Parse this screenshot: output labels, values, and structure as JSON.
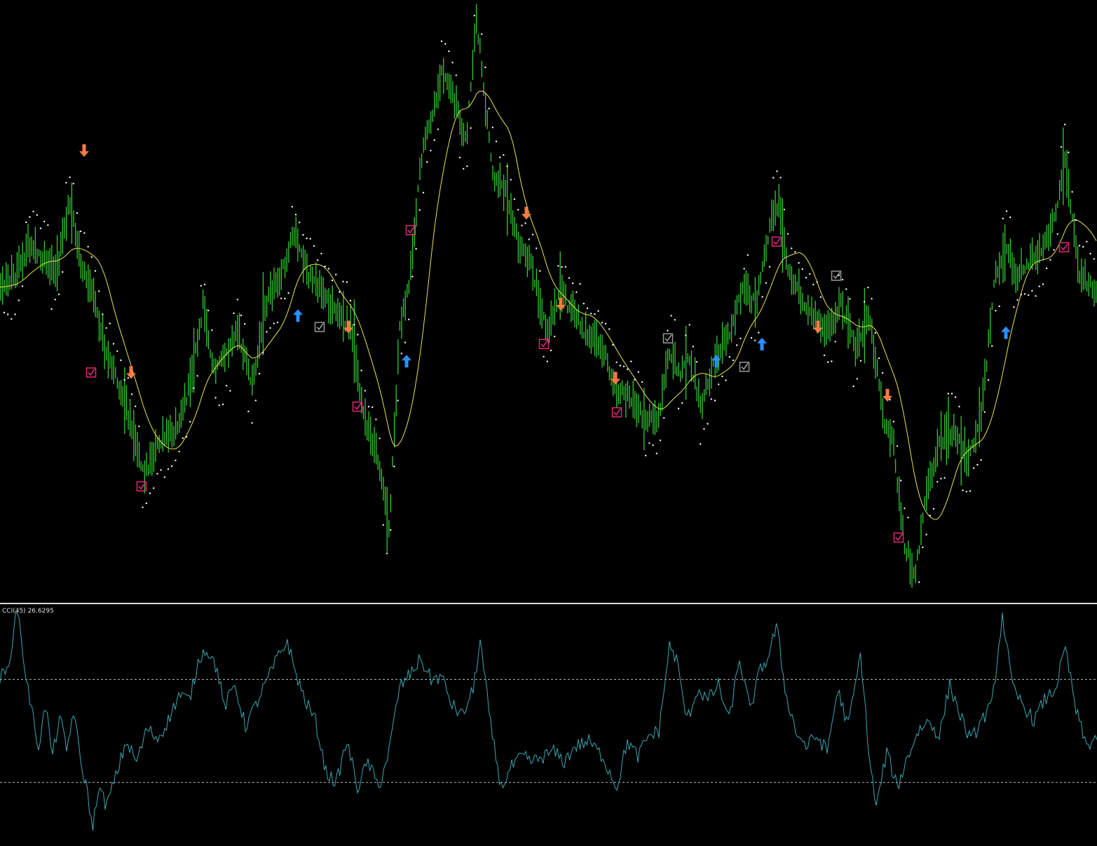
{
  "colors": {
    "background": "#000000",
    "price_bars": "#33cc33",
    "moving_average": "#e6e64d",
    "psar_dots": "#ffffff",
    "cci_line": "#3aa8b4",
    "level_lines": "#bbbbbb",
    "arrow_up": "#2b8fff",
    "arrow_down": "#ff7a45",
    "check_pink": "#e0287a",
    "check_gray": "#9a9a9a",
    "divider": "#d9d9d9"
  },
  "cci_label": {
    "name": "CCI(45)",
    "value": "26.6295"
  },
  "chart_data": [
    {
      "type": "line",
      "panel": "price",
      "x": [
        0,
        22,
        40,
        60,
        80,
        100,
        115,
        130,
        150,
        170,
        190,
        205,
        225,
        250,
        270,
        290,
        305,
        320,
        340,
        360,
        380,
        400,
        420,
        440,
        460,
        480,
        500,
        520,
        540,
        555,
        570,
        585,
        600,
        615,
        630,
        650,
        665,
        680,
        695,
        705,
        720,
        740,
        760,
        780,
        800,
        820,
        840,
        860,
        880,
        900,
        920,
        940,
        955,
        970,
        985,
        1000,
        1020,
        1040,
        1060,
        1080,
        1095,
        1110,
        1125,
        1140,
        1160,
        1180,
        1200,
        1220,
        1240,
        1260,
        1275,
        1290,
        1305,
        1320,
        1340,
        1360,
        1380,
        1400,
        1420,
        1435,
        1450,
        1470,
        1490,
        1505,
        1520,
        1540,
        1565
      ],
      "y": [
        0.53,
        0.55,
        0.6,
        0.58,
        0.55,
        0.68,
        0.57,
        0.52,
        0.42,
        0.35,
        0.28,
        0.2,
        0.25,
        0.28,
        0.35,
        0.5,
        0.38,
        0.4,
        0.45,
        0.36,
        0.5,
        0.55,
        0.62,
        0.55,
        0.52,
        0.48,
        0.46,
        0.3,
        0.22,
        0.1,
        0.45,
        0.55,
        0.75,
        0.82,
        0.9,
        0.85,
        0.78,
        1.0,
        0.82,
        0.72,
        0.7,
        0.6,
        0.56,
        0.45,
        0.52,
        0.48,
        0.44,
        0.42,
        0.35,
        0.33,
        0.3,
        0.3,
        0.42,
        0.38,
        0.4,
        0.32,
        0.4,
        0.45,
        0.52,
        0.5,
        0.62,
        0.68,
        0.55,
        0.52,
        0.48,
        0.45,
        0.5,
        0.42,
        0.48,
        0.3,
        0.25,
        0.08,
        0.02,
        0.15,
        0.25,
        0.28,
        0.22,
        0.3,
        0.55,
        0.6,
        0.55,
        0.58,
        0.6,
        0.65,
        0.75,
        0.55,
        0.52
      ],
      "ylim": [
        0,
        1
      ]
    },
    {
      "type": "line",
      "panel": "cci",
      "x": [
        0,
        10,
        20,
        25,
        35,
        45,
        55,
        65,
        75,
        85,
        95,
        105,
        115,
        125,
        132,
        140,
        152,
        165,
        180,
        195,
        210,
        225,
        240,
        255,
        270,
        285,
        295,
        310,
        320,
        335,
        350,
        365,
        380,
        395,
        410,
        420,
        435,
        450,
        465,
        480,
        495,
        510,
        525,
        540,
        555,
        570,
        585,
        600,
        615,
        630,
        645,
        660,
        675,
        685,
        700,
        715,
        730,
        745,
        760,
        775,
        790,
        805,
        820,
        840,
        860,
        880,
        895,
        910,
        925,
        940,
        955,
        965,
        980,
        995,
        1010,
        1025,
        1040,
        1055,
        1070,
        1085,
        1095,
        1108,
        1120,
        1135,
        1150,
        1165,
        1180,
        1195,
        1210,
        1228,
        1240,
        1250,
        1265,
        1280,
        1295,
        1310,
        1325,
        1340,
        1355,
        1370,
        1385,
        1400,
        1415,
        1430,
        1445,
        1460,
        1475,
        1490,
        1505,
        1520,
        1535,
        1550,
        1565
      ],
      "y": [
        105,
        115,
        195,
        240,
        125,
        40,
        -30,
        50,
        -50,
        30,
        -40,
        40,
        -60,
        -120,
        -195,
        -110,
        -145,
        -90,
        -20,
        -60,
        5,
        -15,
        20,
        70,
        60,
        145,
        160,
        120,
        45,
        90,
        10,
        50,
        95,
        140,
        175,
        120,
        60,
        20,
        -80,
        -100,
        -20,
        -110,
        -60,
        -110,
        -40,
        85,
        110,
        140,
        100,
        105,
        50,
        30,
        80,
        175,
        10,
        -110,
        -70,
        -50,
        -60,
        -50,
        -40,
        -60,
        -30,
        -20,
        -50,
        -110,
        -20,
        -50,
        -10,
        0,
        165,
        140,
        20,
        80,
        60,
        90,
        20,
        140,
        40,
        120,
        140,
        205,
        80,
        0,
        -30,
        -10,
        -40,
        80,
        10,
        150,
        -50,
        -150,
        -40,
        -110,
        -50,
        0,
        20,
        -10,
        90,
        30,
        -20,
        20,
        50,
        225,
        80,
        50,
        20,
        60,
        80,
        160,
        40,
        -30,
        -10,
        -40
      ],
      "ylim": [
        -210,
        230
      ],
      "levels": [
        100,
        -100
      ]
    }
  ],
  "markers": {
    "arrows_up": [
      {
        "x": 425,
        "y": 0.48
      },
      {
        "x": 580,
        "y": 0.4
      },
      {
        "x": 1022,
        "y": 0.4
      },
      {
        "x": 1087,
        "y": 0.43
      },
      {
        "x": 1435,
        "y": 0.45
      }
    ],
    "arrows_down": [
      {
        "x": 120,
        "y": 0.77
      },
      {
        "x": 187,
        "y": 0.38
      },
      {
        "x": 497,
        "y": 0.46
      },
      {
        "x": 751,
        "y": 0.66
      },
      {
        "x": 800,
        "y": 0.5
      },
      {
        "x": 878,
        "y": 0.37
      },
      {
        "x": 1167,
        "y": 0.46
      },
      {
        "x": 1266,
        "y": 0.34
      }
    ],
    "checks_pink": [
      {
        "x": 130,
        "y": 0.38
      },
      {
        "x": 202,
        "y": 0.18
      },
      {
        "x": 510,
        "y": 0.32
      },
      {
        "x": 586,
        "y": 0.63
      },
      {
        "x": 776,
        "y": 0.43
      },
      {
        "x": 880,
        "y": 0.31
      },
      {
        "x": 1108,
        "y": 0.61
      },
      {
        "x": 1282,
        "y": 0.09
      },
      {
        "x": 1518,
        "y": 0.6
      }
    ],
    "checks_gray": [
      {
        "x": 456,
        "y": 0.46
      },
      {
        "x": 953,
        "y": 0.44
      },
      {
        "x": 1062,
        "y": 0.39
      },
      {
        "x": 1193,
        "y": 0.55
      }
    ]
  }
}
